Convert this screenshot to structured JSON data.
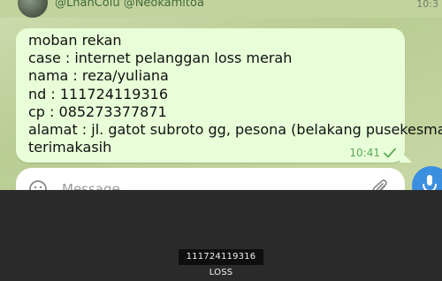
{
  "header": {
    "partial_text": "@LhanColu @Neokamitoa",
    "time_partial": "10:3"
  },
  "message": {
    "lines": [
      "moban rekan",
      "case : internet pelanggan loss merah",
      "nama : reza/yuliana",
      "nd : 111724119316",
      "cp : 085273377871",
      "alamat : jl. gatot subroto gg, pesona (belakang pusekesmas)",
      "terimakasih"
    ],
    "time": "10:41",
    "status_icon": "single-check-icon"
  },
  "input": {
    "placeholder": "Message"
  },
  "caption": {
    "text": "111724119316 LOSS"
  },
  "colors": {
    "bubble": "#e8fed8",
    "chat_background": "#c3d39e",
    "check": "#5aa85a",
    "mic_button": "#3b8fe0",
    "overlay": "#2b2b2b"
  }
}
